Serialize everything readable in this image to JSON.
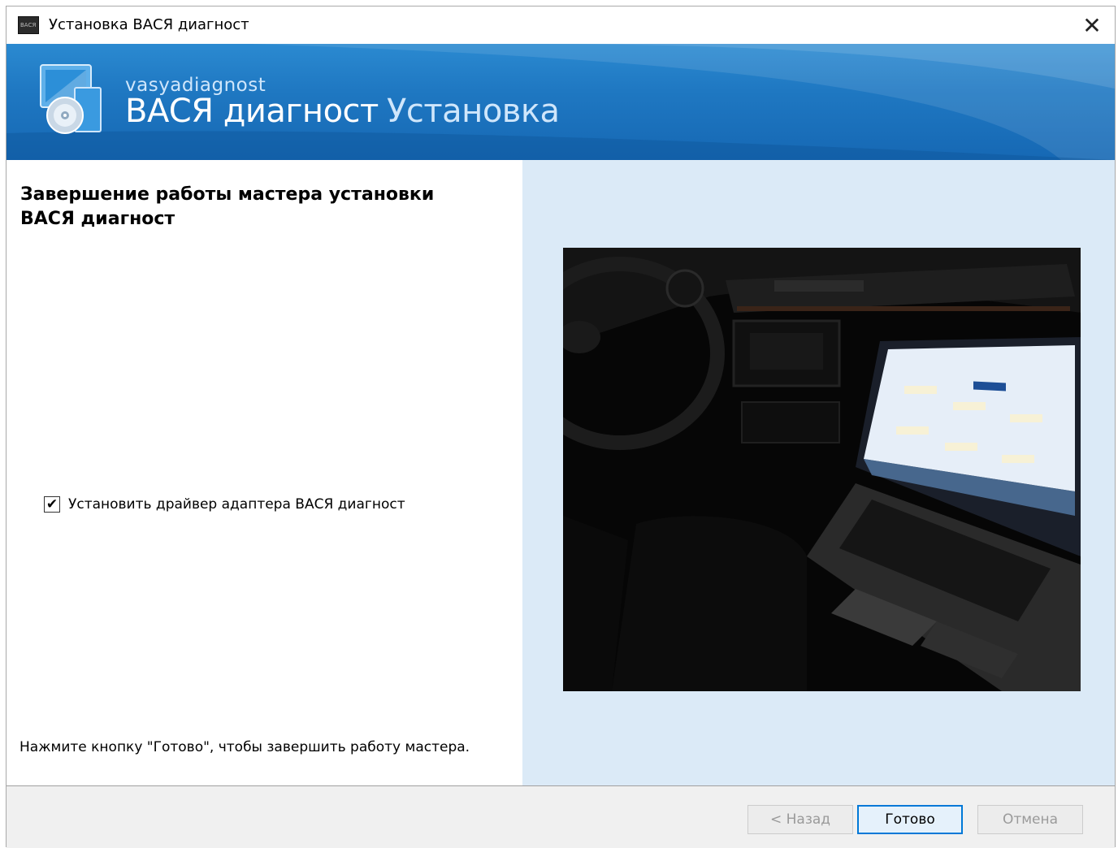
{
  "window": {
    "title": "Установка ВАСЯ диагност",
    "icon": "app-icon",
    "icon_text": "ВАСЯ",
    "close_label": "✕"
  },
  "banner": {
    "small_text": "vasyadiagnost",
    "title": "ВАСЯ диагност",
    "subtitle": "Установка",
    "icon": "installer-disc-icon"
  },
  "content": {
    "heading": "Завершение работы мастера установки ВАСЯ диагност",
    "checkbox": {
      "label": "Установить драйвер адаптера ВАСЯ диагност",
      "checked": true,
      "mark": "✔"
    },
    "footer_note": "Нажмите кнопку \"Готово\", чтобы завершить работу мастера."
  },
  "buttons": {
    "back": "< Назад",
    "finish": "Готово",
    "cancel": "Отмена"
  },
  "colors": {
    "banner": "#1f78c2",
    "right_panel": "#dbeaf7",
    "accent": "#0078d7"
  }
}
